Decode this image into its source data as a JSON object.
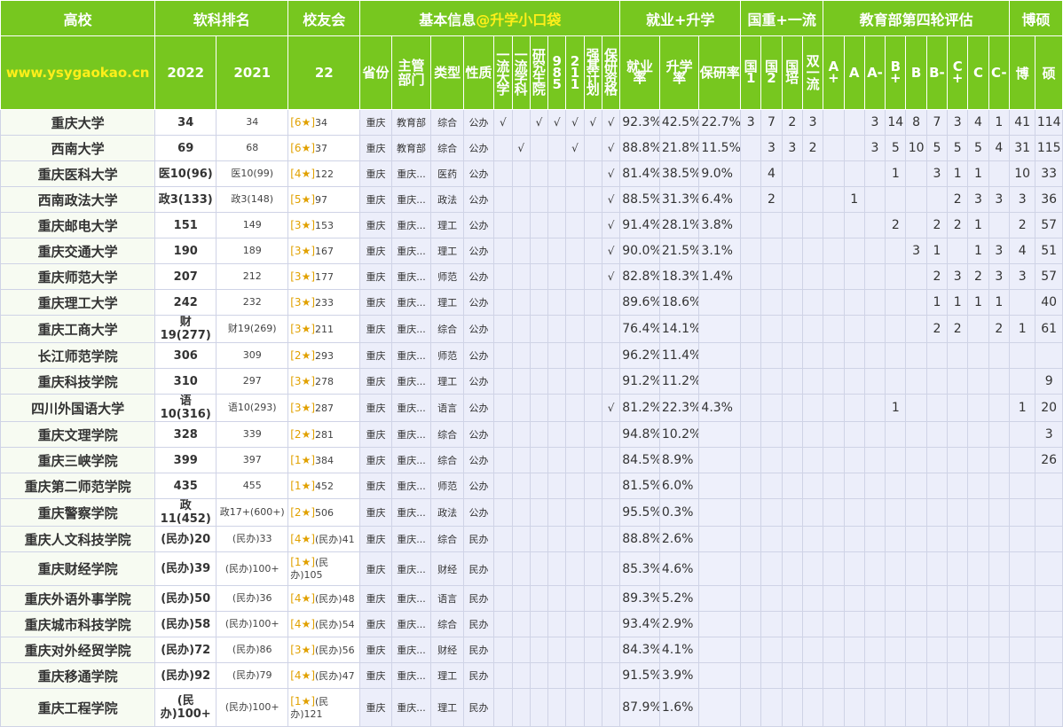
{
  "header": {
    "groups": {
      "university": "高校",
      "ranking": "软科排名",
      "alumni": "校友会",
      "basic_prefix": "基本信息",
      "basic_accent": "@升学小口袋",
      "employment": "就业+升学",
      "national": "国重+一流",
      "evaluation": "教育部第四轮评估",
      "degree": "博硕"
    },
    "sub": {
      "site": "www.ysygaokao.cn",
      "rank_2022": "2022",
      "rank_2021": "2021",
      "alumni_year": "22",
      "province": "省份",
      "dept": "主管部门",
      "type": "类型",
      "nature": "性质",
      "flag_1": "一流大学",
      "flag_2": "一流学科",
      "flag_3": "研究生院",
      "flag_4": "985",
      "flag_5": "211",
      "flag_6": "强基计划",
      "flag_7": "保研资格",
      "emp_rate": "就业率",
      "adv_rate": "升学率",
      "bao_rate": "保研率",
      "nat_1": "国1",
      "nat_2": "国2",
      "nat_3": "国培",
      "nat_4": "双一流",
      "ev_1": "A+",
      "ev_2": "A",
      "ev_3": "A-",
      "ev_4": "B+",
      "ev_5": "B",
      "ev_6": "B-",
      "ev_7": "C+",
      "ev_8": "C",
      "ev_9": "C-",
      "doc": "博",
      "master": "硕"
    }
  },
  "rows": [
    {
      "name": "重庆大学",
      "r22": "34",
      "r21": "34",
      "al_stars": "[6★]",
      "al_rank": "34",
      "prov": "重庆",
      "dept": "教育部",
      "type": "综合",
      "nature": "公办",
      "f1": "√",
      "f2": "",
      "f3": "√",
      "f4": "√",
      "f5": "√",
      "f6": "√",
      "f7": "√",
      "emp": "92.3%",
      "adv": "42.5%",
      "bao": "22.7%",
      "n1": "3",
      "n2": "7",
      "n3": "2",
      "n4": "3",
      "e1": "",
      "e2": "",
      "e3": "3",
      "e4": "14",
      "e5": "8",
      "e6": "7",
      "e7": "3",
      "e8": "4",
      "e9": "1",
      "doc": "41",
      "mas": "114"
    },
    {
      "name": "西南大学",
      "r22": "69",
      "r21": "68",
      "al_stars": "[6★]",
      "al_rank": "37",
      "prov": "重庆",
      "dept": "教育部",
      "type": "综合",
      "nature": "公办",
      "f1": "",
      "f2": "√",
      "f3": "",
      "f4": "",
      "f5": "√",
      "f6": "",
      "f7": "√",
      "emp": "88.8%",
      "adv": "21.8%",
      "bao": "11.5%",
      "n1": "",
      "n2": "3",
      "n3": "3",
      "n4": "2",
      "e1": "",
      "e2": "",
      "e3": "3",
      "e4": "5",
      "e5": "10",
      "e6": "5",
      "e7": "5",
      "e8": "5",
      "e9": "4",
      "doc": "31",
      "mas": "115"
    },
    {
      "name": "重庆医科大学",
      "r22": "医10(96)",
      "r21": "医10(99)",
      "al_stars": "[4★]",
      "al_rank": "122",
      "prov": "重庆",
      "dept": "重庆...",
      "type": "医药",
      "nature": "公办",
      "f1": "",
      "f2": "",
      "f3": "",
      "f4": "",
      "f5": "",
      "f6": "",
      "f7": "√",
      "emp": "81.4%",
      "adv": "38.5%",
      "bao": "9.0%",
      "n1": "",
      "n2": "4",
      "n3": "",
      "n4": "",
      "e1": "",
      "e2": "",
      "e3": "",
      "e4": "1",
      "e5": "",
      "e6": "3",
      "e7": "1",
      "e8": "1",
      "e9": "",
      "doc": "10",
      "mas": "33"
    },
    {
      "name": "西南政法大学",
      "r22": "政3(133)",
      "r21": "政3(148)",
      "al_stars": "[5★]",
      "al_rank": "97",
      "prov": "重庆",
      "dept": "重庆...",
      "type": "政法",
      "nature": "公办",
      "f1": "",
      "f2": "",
      "f3": "",
      "f4": "",
      "f5": "",
      "f6": "",
      "f7": "√",
      "emp": "88.5%",
      "adv": "31.3%",
      "bao": "6.4%",
      "n1": "",
      "n2": "2",
      "n3": "",
      "n4": "",
      "e1": "",
      "e2": "1",
      "e3": "",
      "e4": "",
      "e5": "",
      "e6": "",
      "e7": "2",
      "e8": "3",
      "e9": "3",
      "doc": "3",
      "mas": "36"
    },
    {
      "name": "重庆邮电大学",
      "r22": "151",
      "r21": "149",
      "al_stars": "[3★]",
      "al_rank": "153",
      "prov": "重庆",
      "dept": "重庆...",
      "type": "理工",
      "nature": "公办",
      "f1": "",
      "f2": "",
      "f3": "",
      "f4": "",
      "f5": "",
      "f6": "",
      "f7": "√",
      "emp": "91.4%",
      "adv": "28.1%",
      "bao": "3.8%",
      "n1": "",
      "n2": "",
      "n3": "",
      "n4": "",
      "e1": "",
      "e2": "",
      "e3": "",
      "e4": "2",
      "e5": "",
      "e6": "2",
      "e7": "2",
      "e8": "1",
      "e9": "",
      "doc": "2",
      "mas": "57"
    },
    {
      "name": "重庆交通大学",
      "r22": "190",
      "r21": "189",
      "al_stars": "[3★]",
      "al_rank": "167",
      "prov": "重庆",
      "dept": "重庆...",
      "type": "理工",
      "nature": "公办",
      "f1": "",
      "f2": "",
      "f3": "",
      "f4": "",
      "f5": "",
      "f6": "",
      "f7": "√",
      "emp": "90.0%",
      "adv": "21.5%",
      "bao": "3.1%",
      "n1": "",
      "n2": "",
      "n3": "",
      "n4": "",
      "e1": "",
      "e2": "",
      "e3": "",
      "e4": "",
      "e5": "3",
      "e6": "1",
      "e7": "",
      "e8": "1",
      "e9": "3",
      "doc": "4",
      "mas": "51"
    },
    {
      "name": "重庆师范大学",
      "r22": "207",
      "r21": "212",
      "al_stars": "[3★]",
      "al_rank": "177",
      "prov": "重庆",
      "dept": "重庆...",
      "type": "师范",
      "nature": "公办",
      "f1": "",
      "f2": "",
      "f3": "",
      "f4": "",
      "f5": "",
      "f6": "",
      "f7": "√",
      "emp": "82.8%",
      "adv": "18.3%",
      "bao": "1.4%",
      "n1": "",
      "n2": "",
      "n3": "",
      "n4": "",
      "e1": "",
      "e2": "",
      "e3": "",
      "e4": "",
      "e5": "",
      "e6": "2",
      "e7": "3",
      "e8": "2",
      "e9": "3",
      "doc": "3",
      "mas": "57"
    },
    {
      "name": "重庆理工大学",
      "r22": "242",
      "r21": "232",
      "al_stars": "[3★]",
      "al_rank": "233",
      "prov": "重庆",
      "dept": "重庆...",
      "type": "理工",
      "nature": "公办",
      "f1": "",
      "f2": "",
      "f3": "",
      "f4": "",
      "f5": "",
      "f6": "",
      "f7": "",
      "emp": "89.6%",
      "adv": "18.6%",
      "bao": "",
      "n1": "",
      "n2": "",
      "n3": "",
      "n4": "",
      "e1": "",
      "e2": "",
      "e3": "",
      "e4": "",
      "e5": "",
      "e6": "1",
      "e7": "1",
      "e8": "1",
      "e9": "1",
      "doc": "",
      "mas": "40"
    },
    {
      "name": "重庆工商大学",
      "r22": "财19(277)",
      "r21": "财19(269)",
      "al_stars": "[3★]",
      "al_rank": "211",
      "prov": "重庆",
      "dept": "重庆...",
      "type": "综合",
      "nature": "公办",
      "f1": "",
      "f2": "",
      "f3": "",
      "f4": "",
      "f5": "",
      "f6": "",
      "f7": "",
      "emp": "76.4%",
      "adv": "14.1%",
      "bao": "",
      "n1": "",
      "n2": "",
      "n3": "",
      "n4": "",
      "e1": "",
      "e2": "",
      "e3": "",
      "e4": "",
      "e5": "",
      "e6": "2",
      "e7": "2",
      "e8": "",
      "e9": "2",
      "doc": "1",
      "mas": "61"
    },
    {
      "name": "长江师范学院",
      "r22": "306",
      "r21": "309",
      "al_stars": "[2★]",
      "al_rank": "293",
      "prov": "重庆",
      "dept": "重庆...",
      "type": "师范",
      "nature": "公办",
      "f1": "",
      "f2": "",
      "f3": "",
      "f4": "",
      "f5": "",
      "f6": "",
      "f7": "",
      "emp": "96.2%",
      "adv": "11.4%",
      "bao": "",
      "n1": "",
      "n2": "",
      "n3": "",
      "n4": "",
      "e1": "",
      "e2": "",
      "e3": "",
      "e4": "",
      "e5": "",
      "e6": "",
      "e7": "",
      "e8": "",
      "e9": "",
      "doc": "",
      "mas": ""
    },
    {
      "name": "重庆科技学院",
      "r22": "310",
      "r21": "297",
      "al_stars": "[3★]",
      "al_rank": "278",
      "prov": "重庆",
      "dept": "重庆...",
      "type": "理工",
      "nature": "公办",
      "f1": "",
      "f2": "",
      "f3": "",
      "f4": "",
      "f5": "",
      "f6": "",
      "f7": "",
      "emp": "91.2%",
      "adv": "11.2%",
      "bao": "",
      "n1": "",
      "n2": "",
      "n3": "",
      "n4": "",
      "e1": "",
      "e2": "",
      "e3": "",
      "e4": "",
      "e5": "",
      "e6": "",
      "e7": "",
      "e8": "",
      "e9": "",
      "doc": "",
      "mas": "9"
    },
    {
      "name": "四川外国语大学",
      "r22": "语10(316)",
      "r21": "语10(293)",
      "al_stars": "[3★]",
      "al_rank": "287",
      "prov": "重庆",
      "dept": "重庆...",
      "type": "语言",
      "nature": "公办",
      "f1": "",
      "f2": "",
      "f3": "",
      "f4": "",
      "f5": "",
      "f6": "",
      "f7": "√",
      "emp": "81.2%",
      "adv": "22.3%",
      "bao": "4.3%",
      "n1": "",
      "n2": "",
      "n3": "",
      "n4": "",
      "e1": "",
      "e2": "",
      "e3": "",
      "e4": "1",
      "e5": "",
      "e6": "",
      "e7": "",
      "e8": "",
      "e9": "",
      "doc": "1",
      "mas": "20"
    },
    {
      "name": "重庆文理学院",
      "r22": "328",
      "r21": "339",
      "al_stars": "[2★]",
      "al_rank": "281",
      "prov": "重庆",
      "dept": "重庆...",
      "type": "综合",
      "nature": "公办",
      "f1": "",
      "f2": "",
      "f3": "",
      "f4": "",
      "f5": "",
      "f6": "",
      "f7": "",
      "emp": "94.8%",
      "adv": "10.2%",
      "bao": "",
      "n1": "",
      "n2": "",
      "n3": "",
      "n4": "",
      "e1": "",
      "e2": "",
      "e3": "",
      "e4": "",
      "e5": "",
      "e6": "",
      "e7": "",
      "e8": "",
      "e9": "",
      "doc": "",
      "mas": "3"
    },
    {
      "name": "重庆三峡学院",
      "r22": "399",
      "r21": "397",
      "al_stars": "[1★]",
      "al_rank": "384",
      "prov": "重庆",
      "dept": "重庆...",
      "type": "综合",
      "nature": "公办",
      "f1": "",
      "f2": "",
      "f3": "",
      "f4": "",
      "f5": "",
      "f6": "",
      "f7": "",
      "emp": "84.5%",
      "adv": "8.9%",
      "bao": "",
      "n1": "",
      "n2": "",
      "n3": "",
      "n4": "",
      "e1": "",
      "e2": "",
      "e3": "",
      "e4": "",
      "e5": "",
      "e6": "",
      "e7": "",
      "e8": "",
      "e9": "",
      "doc": "",
      "mas": "26"
    },
    {
      "name": "重庆第二师范学院",
      "r22": "435",
      "r21": "455",
      "al_stars": "[1★]",
      "al_rank": "452",
      "prov": "重庆",
      "dept": "重庆...",
      "type": "师范",
      "nature": "公办",
      "f1": "",
      "f2": "",
      "f3": "",
      "f4": "",
      "f5": "",
      "f6": "",
      "f7": "",
      "emp": "81.5%",
      "adv": "6.0%",
      "bao": "",
      "n1": "",
      "n2": "",
      "n3": "",
      "n4": "",
      "e1": "",
      "e2": "",
      "e3": "",
      "e4": "",
      "e5": "",
      "e6": "",
      "e7": "",
      "e8": "",
      "e9": "",
      "doc": "",
      "mas": ""
    },
    {
      "name": "重庆警察学院",
      "r22": "政11(452)",
      "r21": "政17+(600+)",
      "al_stars": "[2★]",
      "al_rank": "506",
      "prov": "重庆",
      "dept": "重庆...",
      "type": "政法",
      "nature": "公办",
      "f1": "",
      "f2": "",
      "f3": "",
      "f4": "",
      "f5": "",
      "f6": "",
      "f7": "",
      "emp": "95.5%",
      "adv": "0.3%",
      "bao": "",
      "n1": "",
      "n2": "",
      "n3": "",
      "n4": "",
      "e1": "",
      "e2": "",
      "e3": "",
      "e4": "",
      "e5": "",
      "e6": "",
      "e7": "",
      "e8": "",
      "e9": "",
      "doc": "",
      "mas": ""
    },
    {
      "name": "重庆人文科技学院",
      "r22": "(民办)20",
      "r21": "(民办)33",
      "al_stars": "[4★]",
      "al_rank": "(民办)41",
      "prov": "重庆",
      "dept": "重庆...",
      "type": "综合",
      "nature": "民办",
      "f1": "",
      "f2": "",
      "f3": "",
      "f4": "",
      "f5": "",
      "f6": "",
      "f7": "",
      "emp": "88.8%",
      "adv": "2.6%",
      "bao": "",
      "n1": "",
      "n2": "",
      "n3": "",
      "n4": "",
      "e1": "",
      "e2": "",
      "e3": "",
      "e4": "",
      "e5": "",
      "e6": "",
      "e7": "",
      "e8": "",
      "e9": "",
      "doc": "",
      "mas": ""
    },
    {
      "name": "重庆财经学院",
      "r22": "(民办)39",
      "r21": "(民办)100+",
      "al_stars": "[1★]",
      "al_rank": "(民办)105",
      "prov": "重庆",
      "dept": "重庆...",
      "type": "财经",
      "nature": "民办",
      "f1": "",
      "f2": "",
      "f3": "",
      "f4": "",
      "f5": "",
      "f6": "",
      "f7": "",
      "emp": "85.3%",
      "adv": "4.6%",
      "bao": "",
      "n1": "",
      "n2": "",
      "n3": "",
      "n4": "",
      "e1": "",
      "e2": "",
      "e3": "",
      "e4": "",
      "e5": "",
      "e6": "",
      "e7": "",
      "e8": "",
      "e9": "",
      "doc": "",
      "mas": ""
    },
    {
      "name": "重庆外语外事学院",
      "r22": "(民办)50",
      "r21": "(民办)36",
      "al_stars": "[4★]",
      "al_rank": "(民办)48",
      "prov": "重庆",
      "dept": "重庆...",
      "type": "语言",
      "nature": "民办",
      "f1": "",
      "f2": "",
      "f3": "",
      "f4": "",
      "f5": "",
      "f6": "",
      "f7": "",
      "emp": "89.3%",
      "adv": "5.2%",
      "bao": "",
      "n1": "",
      "n2": "",
      "n3": "",
      "n4": "",
      "e1": "",
      "e2": "",
      "e3": "",
      "e4": "",
      "e5": "",
      "e6": "",
      "e7": "",
      "e8": "",
      "e9": "",
      "doc": "",
      "mas": ""
    },
    {
      "name": "重庆城市科技学院",
      "r22": "(民办)58",
      "r21": "(民办)100+",
      "al_stars": "[4★]",
      "al_rank": "(民办)54",
      "prov": "重庆",
      "dept": "重庆...",
      "type": "综合",
      "nature": "民办",
      "f1": "",
      "f2": "",
      "f3": "",
      "f4": "",
      "f5": "",
      "f6": "",
      "f7": "",
      "emp": "93.4%",
      "adv": "2.9%",
      "bao": "",
      "n1": "",
      "n2": "",
      "n3": "",
      "n4": "",
      "e1": "",
      "e2": "",
      "e3": "",
      "e4": "",
      "e5": "",
      "e6": "",
      "e7": "",
      "e8": "",
      "e9": "",
      "doc": "",
      "mas": ""
    },
    {
      "name": "重庆对外经贸学院",
      "r22": "(民办)72",
      "r21": "(民办)86",
      "al_stars": "[3★]",
      "al_rank": "(民办)56",
      "prov": "重庆",
      "dept": "重庆...",
      "type": "财经",
      "nature": "民办",
      "f1": "",
      "f2": "",
      "f3": "",
      "f4": "",
      "f5": "",
      "f6": "",
      "f7": "",
      "emp": "84.3%",
      "adv": "4.1%",
      "bao": "",
      "n1": "",
      "n2": "",
      "n3": "",
      "n4": "",
      "e1": "",
      "e2": "",
      "e3": "",
      "e4": "",
      "e5": "",
      "e6": "",
      "e7": "",
      "e8": "",
      "e9": "",
      "doc": "",
      "mas": ""
    },
    {
      "name": "重庆移通学院",
      "r22": "(民办)92",
      "r21": "(民办)79",
      "al_stars": "[4★]",
      "al_rank": "(民办)47",
      "prov": "重庆",
      "dept": "重庆...",
      "type": "理工",
      "nature": "民办",
      "f1": "",
      "f2": "",
      "f3": "",
      "f4": "",
      "f5": "",
      "f6": "",
      "f7": "",
      "emp": "91.5%",
      "adv": "3.9%",
      "bao": "",
      "n1": "",
      "n2": "",
      "n3": "",
      "n4": "",
      "e1": "",
      "e2": "",
      "e3": "",
      "e4": "",
      "e5": "",
      "e6": "",
      "e7": "",
      "e8": "",
      "e9": "",
      "doc": "",
      "mas": ""
    },
    {
      "name": "重庆工程学院",
      "r22": "(民办)100+",
      "r21": "(民办)100+",
      "al_stars": "[1★]",
      "al_rank": "(民办)121",
      "prov": "重庆",
      "dept": "重庆...",
      "type": "理工",
      "nature": "民办",
      "f1": "",
      "f2": "",
      "f3": "",
      "f4": "",
      "f5": "",
      "f6": "",
      "f7": "",
      "emp": "87.9%",
      "adv": "1.6%",
      "bao": "",
      "n1": "",
      "n2": "",
      "n3": "",
      "n4": "",
      "e1": "",
      "e2": "",
      "e3": "",
      "e4": "",
      "e5": "",
      "e6": "",
      "e7": "",
      "e8": "",
      "e9": "",
      "doc": "",
      "mas": ""
    }
  ]
}
